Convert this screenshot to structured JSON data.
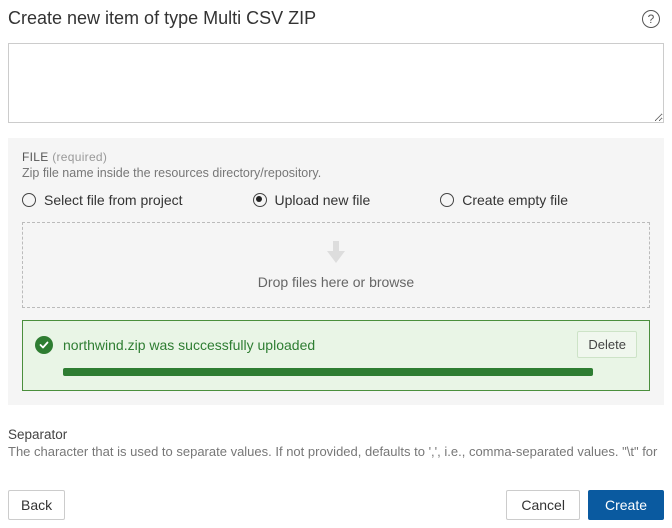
{
  "header": {
    "title": "Create new item of type Multi CSV ZIP"
  },
  "description": {
    "value": "",
    "placeholder": ""
  },
  "file_section": {
    "label": "FILE",
    "required": "(required)",
    "help": "Zip file name inside the resources directory/repository.",
    "options": {
      "select_project": "Select file from project",
      "upload_new": "Upload new file",
      "create_empty": "Create empty file"
    },
    "drop_text": "Drop files here or browse",
    "upload": {
      "message": "northwind.zip was successfully uploaded",
      "delete_label": "Delete",
      "progress_pct": 100
    }
  },
  "separator": {
    "title": "Separator",
    "desc": "The character that is used to separate values. If not provided, defaults to ',', i.e., comma-separated values. \"\\t\" for"
  },
  "footer": {
    "back": "Back",
    "cancel": "Cancel",
    "create": "Create"
  }
}
